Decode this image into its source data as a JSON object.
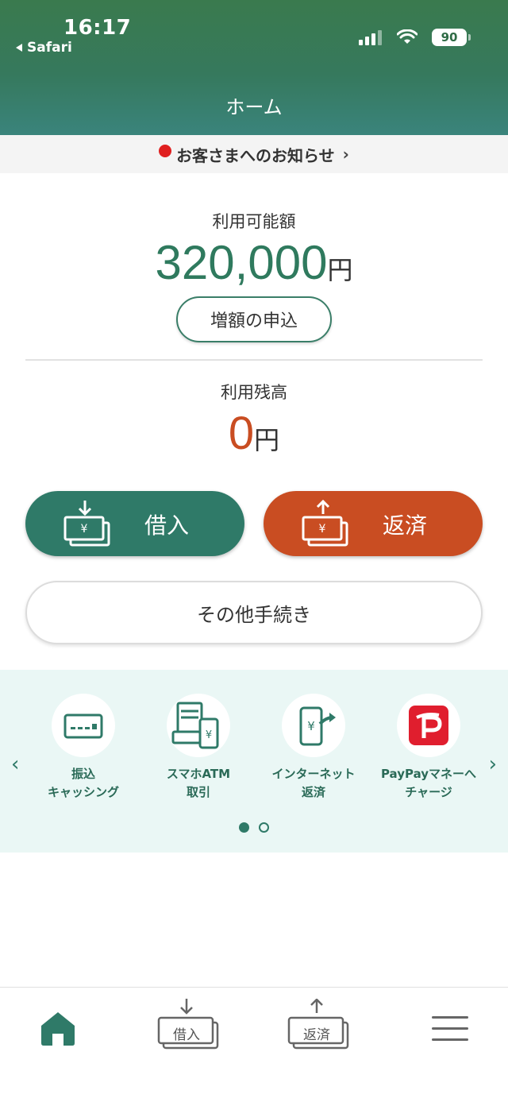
{
  "status_bar": {
    "time": "16:17",
    "back_label": "Safari",
    "battery": "90"
  },
  "nav": {
    "title": "ホーム"
  },
  "notice": {
    "text": "お客さまへのお知らせ",
    "chevron": "›"
  },
  "available": {
    "label": "利用可能額",
    "amount": "320,000",
    "unit": "円",
    "button_label": "増額の申込"
  },
  "balance": {
    "label": "利用残高",
    "amount": "0",
    "unit": "円"
  },
  "actions": {
    "borrow_label": "借入",
    "repay_label": "返済",
    "other_label": "その他手続き",
    "yen": "¥"
  },
  "carousel": {
    "items": [
      {
        "label": "振込\nキャッシング",
        "icon": "card-icon"
      },
      {
        "label": "スマホATM\n取引",
        "icon": "atm-phone-icon"
      },
      {
        "label": "インターネット\n返済",
        "icon": "phone-yen-icon"
      },
      {
        "label": "PayPayマネーへ\nチャージ",
        "icon": "paypay-icon"
      }
    ],
    "prev": "‹",
    "next": "›",
    "page_count": 2,
    "active_page": 1
  },
  "tabbar": {
    "borrow": "借入",
    "repay": "返済"
  },
  "colors": {
    "brand_green": "#2f7a68",
    "accent_orange": "#c94d22",
    "notice_red": "#e02020"
  }
}
